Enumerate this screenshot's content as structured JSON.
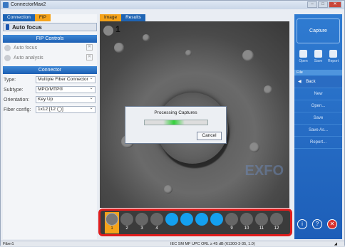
{
  "window": {
    "title": "ConnectorMax2"
  },
  "left_tabs": [
    "Connection",
    "FIP"
  ],
  "autofocus_header": "Auto focus",
  "fip_controls": {
    "title": "FIP Controls",
    "items": [
      {
        "label": "Auto focus"
      },
      {
        "label": "Auto analysis"
      }
    ]
  },
  "connector": {
    "title": "Connector",
    "fields": [
      {
        "label": "Type:",
        "value": "Multiple Fiber Connector"
      },
      {
        "label": "Subtype:",
        "value": "MPO/MTP®"
      },
      {
        "label": "Orientation:",
        "value": "Key Up"
      },
      {
        "label": "Fiber config:",
        "value": "1x12  [12 ◯]"
      }
    ]
  },
  "image_tabs": [
    "Image",
    "Results"
  ],
  "image": {
    "fiber_number": "1",
    "watermark": "EXFO"
  },
  "dialog": {
    "title": "Processing Captures",
    "progress": 0.5,
    "cancel": "Cancel"
  },
  "capture_strip": {
    "slots": [
      {
        "n": "1",
        "state": "selected"
      },
      {
        "n": "2",
        "state": "gray"
      },
      {
        "n": "3",
        "state": "gray"
      },
      {
        "n": "4",
        "state": "gray"
      },
      {
        "n": "",
        "state": "blue"
      },
      {
        "n": "",
        "state": "blue"
      },
      {
        "n": "",
        "state": "blue"
      },
      {
        "n": "",
        "state": "blue"
      },
      {
        "n": "9",
        "state": "gray"
      },
      {
        "n": "10",
        "state": "gray"
      },
      {
        "n": "11",
        "state": "gray"
      },
      {
        "n": "12",
        "state": "gray"
      }
    ]
  },
  "right_panel": {
    "capture": "Capture",
    "tools": [
      "Open",
      "Save",
      "Report"
    ],
    "file_header": "File",
    "menu": [
      "Back",
      "New",
      "Open...",
      "Save",
      "Save As...",
      "Report..."
    ]
  },
  "status": {
    "left": "Fiber1",
    "center": "IEC SM MF UPC ORL ≥ 45 dB (61300-3-35, 1.0)"
  }
}
